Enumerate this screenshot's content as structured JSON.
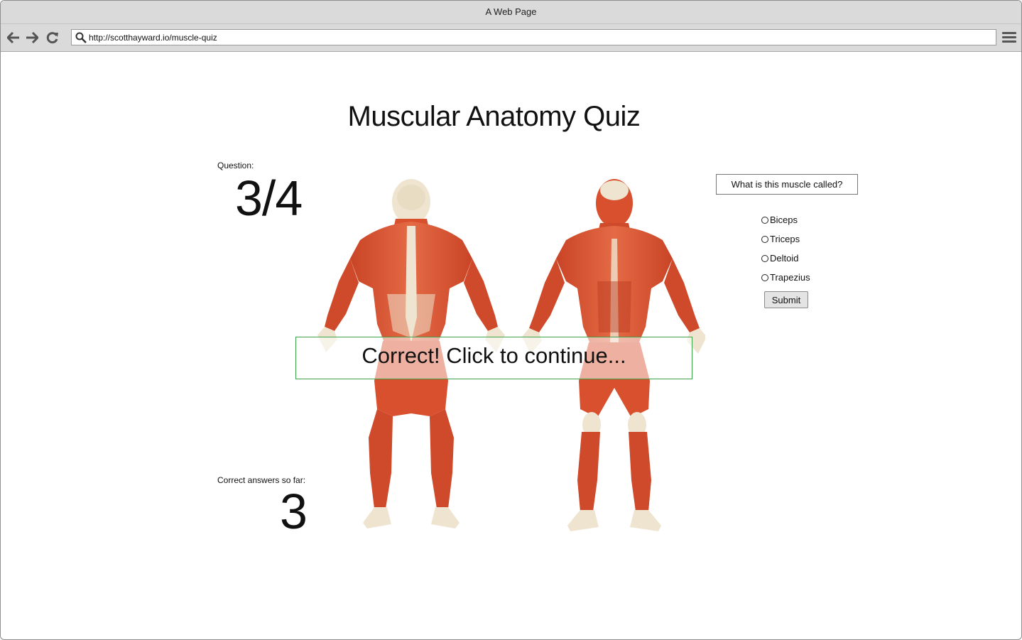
{
  "browser": {
    "window_title": "A Web Page",
    "url": "http://scotthayward.io/muscle-quiz"
  },
  "quiz": {
    "title": "Muscular Anatomy Quiz",
    "question_label": "Question:",
    "question_progress": "3/4",
    "correct_label": "Correct answers so far:",
    "correct_count": "3",
    "prompt": "What is this muscle called?",
    "options": [
      "Biceps",
      "Triceps",
      "Deltoid",
      "Trapezius"
    ],
    "submit_label": "Submit",
    "feedback": "Correct!  Click to continue..."
  },
  "colors": {
    "feedback_border": "#3aa34a",
    "muscle": "#d9502f",
    "tendon": "#efe4cf"
  },
  "icons": [
    "back-arrow-icon",
    "forward-arrow-icon",
    "reload-icon",
    "search-icon",
    "hamburger-menu-icon"
  ]
}
